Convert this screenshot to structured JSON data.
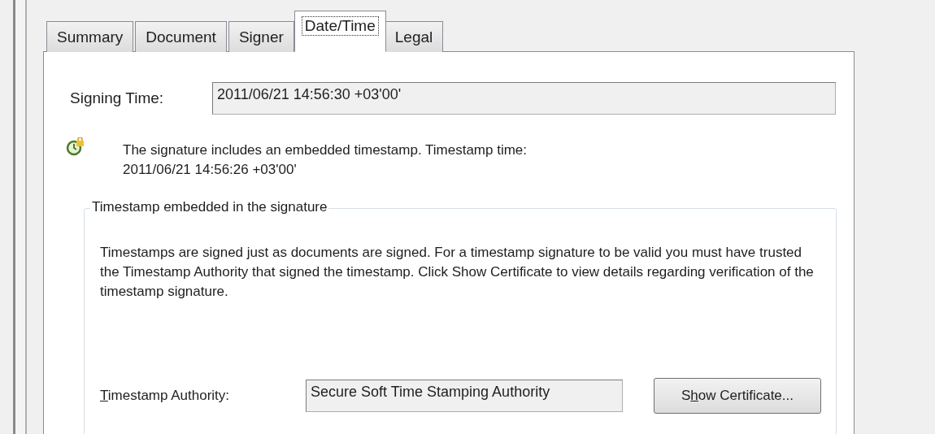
{
  "tabs": [
    {
      "label": "Summary",
      "selected": false
    },
    {
      "label": "Document",
      "selected": false
    },
    {
      "label": "Signer",
      "selected": false
    },
    {
      "label": "Date/Time",
      "selected": true
    },
    {
      "label": "Legal",
      "selected": false
    }
  ],
  "signing_time": {
    "label": "Signing Time:",
    "value": "2011/06/21 14:56:30 +03'00'"
  },
  "notice": {
    "line_1": "The signature includes an embedded timestamp. Timestamp time:",
    "line_2": "2011/06/21 14:56:26 +03'00'"
  },
  "group": {
    "title": "Timestamp embedded in the signature",
    "description": "Timestamps are signed just as documents are signed. For a timestamp signature to be valid you must have trusted the Timestamp Authority that signed the timestamp. Click Show Certificate to view details regarding verification of the timestamp signature.",
    "authority": {
      "access_key": "T",
      "label_rest": "imestamp Authority:",
      "value": "Secure Soft Time Stamping Authority"
    },
    "button": {
      "label_before": "S",
      "access_key": "h",
      "label_after": "ow Certificate..."
    }
  }
}
